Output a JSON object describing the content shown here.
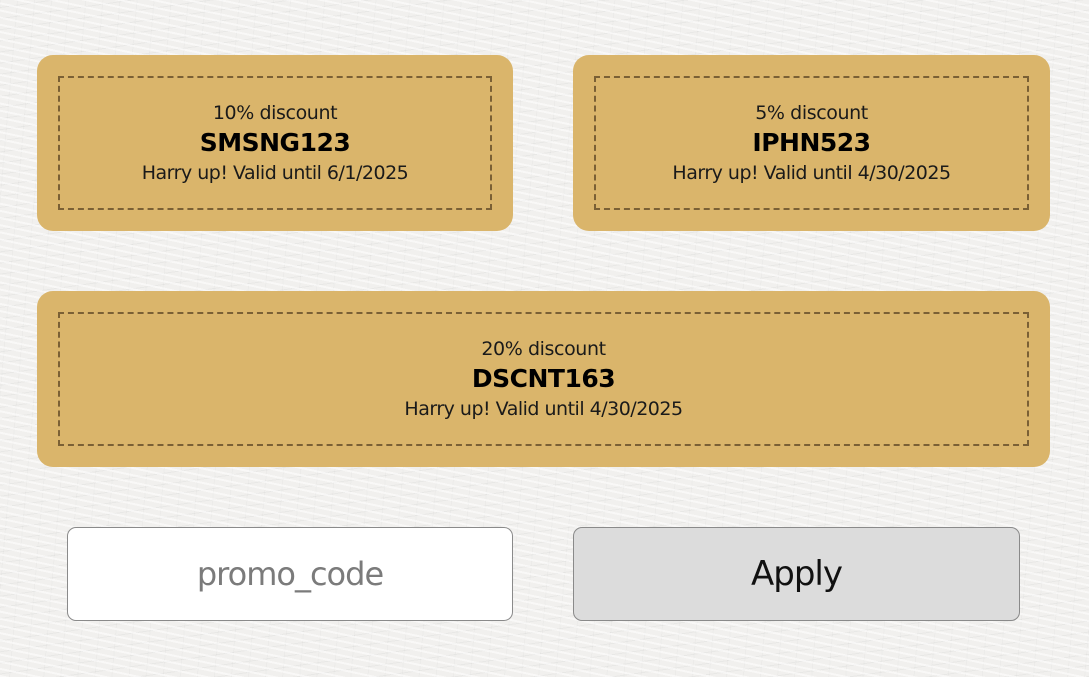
{
  "coupons": [
    {
      "discount": "10% discount",
      "code": "SMSNG123",
      "validity": "Harry up! Valid until 6/1/2025"
    },
    {
      "discount": "5% discount",
      "code": "IPHN523",
      "validity": "Harry up! Valid until 4/30/2025"
    },
    {
      "discount": "20% discount",
      "code": "DSCNT163",
      "validity": "Harry up! Valid until 4/30/2025"
    }
  ],
  "promo": {
    "input_value": "",
    "placeholder": "promo_code",
    "apply_label": "Apply"
  },
  "colors": {
    "coupon_background": "#dab56b",
    "coupon_dashed_border": "#7a6035",
    "apply_button_background": "#dcdcdc",
    "input_background": "#ffffff",
    "page_background": "#f1f0ee"
  }
}
